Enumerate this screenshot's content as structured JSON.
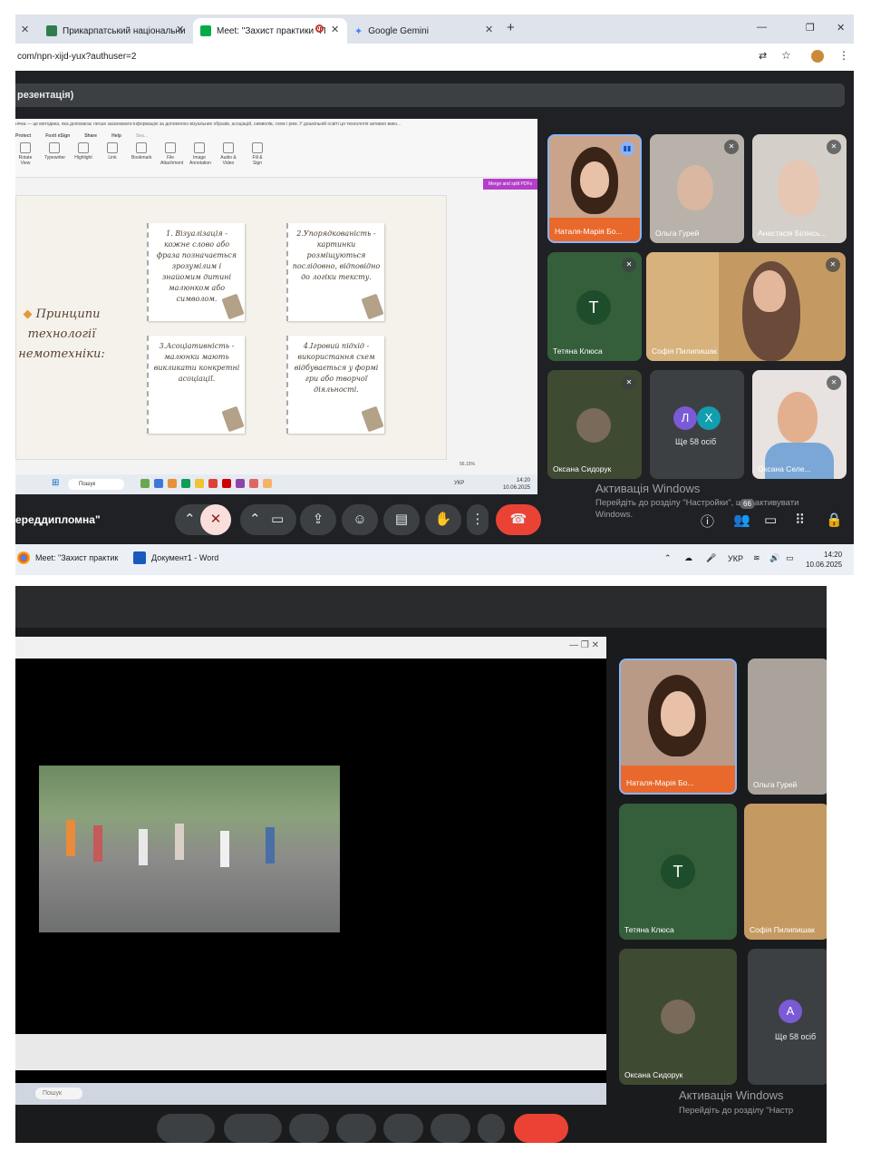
{
  "browser": {
    "tabs": [
      {
        "label": "Прикарпатський національни",
        "active": false
      },
      {
        "label": "Meet: \"Захист практики \"П",
        "active": true
      },
      {
        "label": "Google Gemini",
        "active": false
      }
    ],
    "new_tab": "+",
    "url": "com/npn-xijd-yux?authuser=2"
  },
  "meet": {
    "presentation_title": "резентація)",
    "meeting_name": "ереддипломна\"",
    "participants_count": "66",
    "more_participants": "Ще 58 осіб",
    "more_initials": [
      "Л",
      "Х"
    ],
    "tiles": [
      {
        "name": "Наталя-Марія Бо...",
        "speaking": true
      },
      {
        "name": "Ольга Гурей",
        "speaking": false
      },
      {
        "name": "Анастасія Білінсь...",
        "speaking": false
      },
      {
        "name": "Тетяна Клюса",
        "initial": "T",
        "speaking": false
      },
      {
        "name": "Софія Пилипишак",
        "speaking": false
      },
      {
        "name": "Оксана Сидорук",
        "speaking": false
      },
      {
        "name": "Оксана Селе...",
        "speaking": false
      }
    ]
  },
  "pdf": {
    "doc_text": "нічка — це методика, яка допомагає легше засвоювати інформацію за допомогою візуальних образів, асоціацій, символів, схем і рим. У дошкільній освіті ця технологія активно вико...",
    "menu": [
      "Protect",
      "Foxit eSign",
      "Share",
      "Help"
    ],
    "search": "Sea...",
    "tools": [
      "Rotate View",
      "Typewriter",
      "Highlight",
      "Link",
      "Bookmark",
      "File Attachment",
      "Image Annotation",
      "Audio & Video",
      "Fill & Sign"
    ],
    "merge_button": "Merge and split PDFs",
    "zoom": "56.15%"
  },
  "slide": {
    "title_lines": [
      "Принципи",
      "технології",
      "немотехніки:"
    ],
    "cards": [
      "1. Візуалізація - кожне слово або фраза позначається зрозумілим і знайомим дитині малюнком або символом.",
      "2.Упорядкованість - картинки розміщуються послідовно, відповідно до логіки тексту.",
      "3.Асоціативність - малюнки мають викликати конкретні асоціації.",
      "4.Ігровий підхід - використання схем відбувається у формі гри або творчої діяльності."
    ]
  },
  "inner_taskbar": {
    "search": "Пошук",
    "lang": "УКР",
    "time": "14:20",
    "date": "10.06.2025"
  },
  "activation": {
    "title": "Активація Windows",
    "body": "Перейдіть до розділу \"Настройки\", щоб активувати Windows."
  },
  "windows_taskbar": {
    "items": [
      "Meet: \"Захист практик",
      "Документ1 - Word"
    ],
    "lang": "УКР",
    "time": "14:20",
    "date": "10.06.2025"
  },
  "second_shot": {
    "tiles": [
      "Наталя-Марія Бо...",
      "Ольга Гурей",
      "Тетяна Клюса",
      "Софія Пилипишак",
      "Оксана Сидорук"
    ],
    "initials": [
      "Т",
      "А"
    ],
    "more": "Ще 58 осіб",
    "activation_title": "Активація Windows",
    "activation_body": "Перейдіть до розділу \"Настр",
    "search": "Пошук"
  },
  "colors": {
    "meet_bg": "#202124",
    "end_call": "#ea4335",
    "mic_off": "#f9dedc",
    "speaking": "#8ab4f8",
    "merge": "#b43ec9"
  }
}
